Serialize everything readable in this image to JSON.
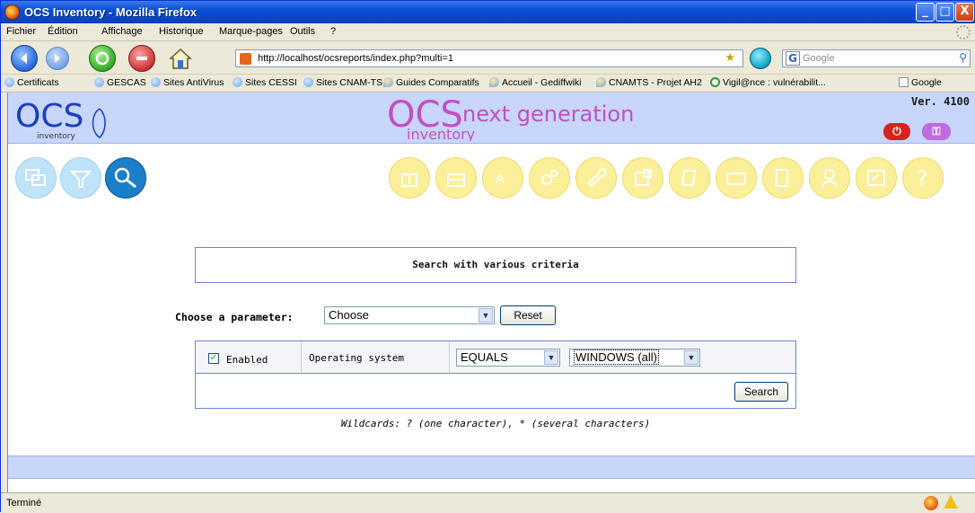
{
  "window": {
    "title": "OCS Inventory - Mozilla Firefox",
    "controls": {
      "minimize": "_",
      "maximize": "□",
      "close": "X"
    }
  },
  "menu": [
    "Fichier",
    "Édition",
    "Affichage",
    "Historique",
    "Marque-pages",
    "Outils",
    "?"
  ],
  "navbar": {
    "url": "http://localhost/ocsreports/index.php?multi=1",
    "search_placeholder": "Google",
    "search_engine": "G"
  },
  "bookmarks": [
    {
      "label": "Certificats",
      "icon": "folder-icon"
    },
    {
      "label": "GESCAS",
      "icon": "folder-icon"
    },
    {
      "label": "Sites AntiVirus",
      "icon": "folder-icon"
    },
    {
      "label": "Sites CESSI",
      "icon": "folder-icon"
    },
    {
      "label": "Sites CNAM-TS",
      "icon": "folder-icon"
    },
    {
      "label": "Guides Comparatifs",
      "icon": "pin-icon"
    },
    {
      "label": "Accueil - Gediffwiki",
      "icon": "pin-icon"
    },
    {
      "label": "CNAMTS - Projet AH2",
      "icon": "pin-icon"
    },
    {
      "label": "Vigil@nce : vulnérabilit...",
      "icon": "eye-icon"
    },
    {
      "label": "Google",
      "icon": "google-icon"
    }
  ],
  "ocs": {
    "logo_left_big": "OCS",
    "logo_left_sub": "inventory",
    "logo_mid_big": "OCS",
    "logo_mid_rest": "next generation",
    "logo_mid_sub": "inventory",
    "version": "Ver. 4100",
    "logout_icon": "power-icon",
    "key_icon": "key-icon",
    "left_icons": [
      "computers-icon",
      "filter-icon",
      "search-icon"
    ],
    "right_icons": [
      "gift-icon",
      "firewall-icon",
      "dictionary-icon",
      "gears-icon",
      "wrench-icon",
      "registry-icon",
      "document-icon",
      "card-icon",
      "labels-icon",
      "users-icon",
      "restore-icon",
      "help-icon"
    ]
  },
  "search": {
    "title": "Search with various criteria",
    "param_label": "Choose a parameter:",
    "param_value": "Choose",
    "reset_label": "Reset",
    "criteria": {
      "enabled": true,
      "enabled_label": "Enabled",
      "field": "Operating system",
      "operator": "EQUALS",
      "value": "WINDOWS (all)"
    },
    "search_label": "Search",
    "wildcards": "Wildcards: ? (one character), * (several characters)"
  },
  "status": {
    "text": "Terminé"
  },
  "colors": {
    "header_band": "#c8d6fc",
    "panel_border": "#6f82d4",
    "icon_yellow": "#fbef9a",
    "icon_blue": "#bfe3f8",
    "icon_active": "#1a7fc8"
  }
}
